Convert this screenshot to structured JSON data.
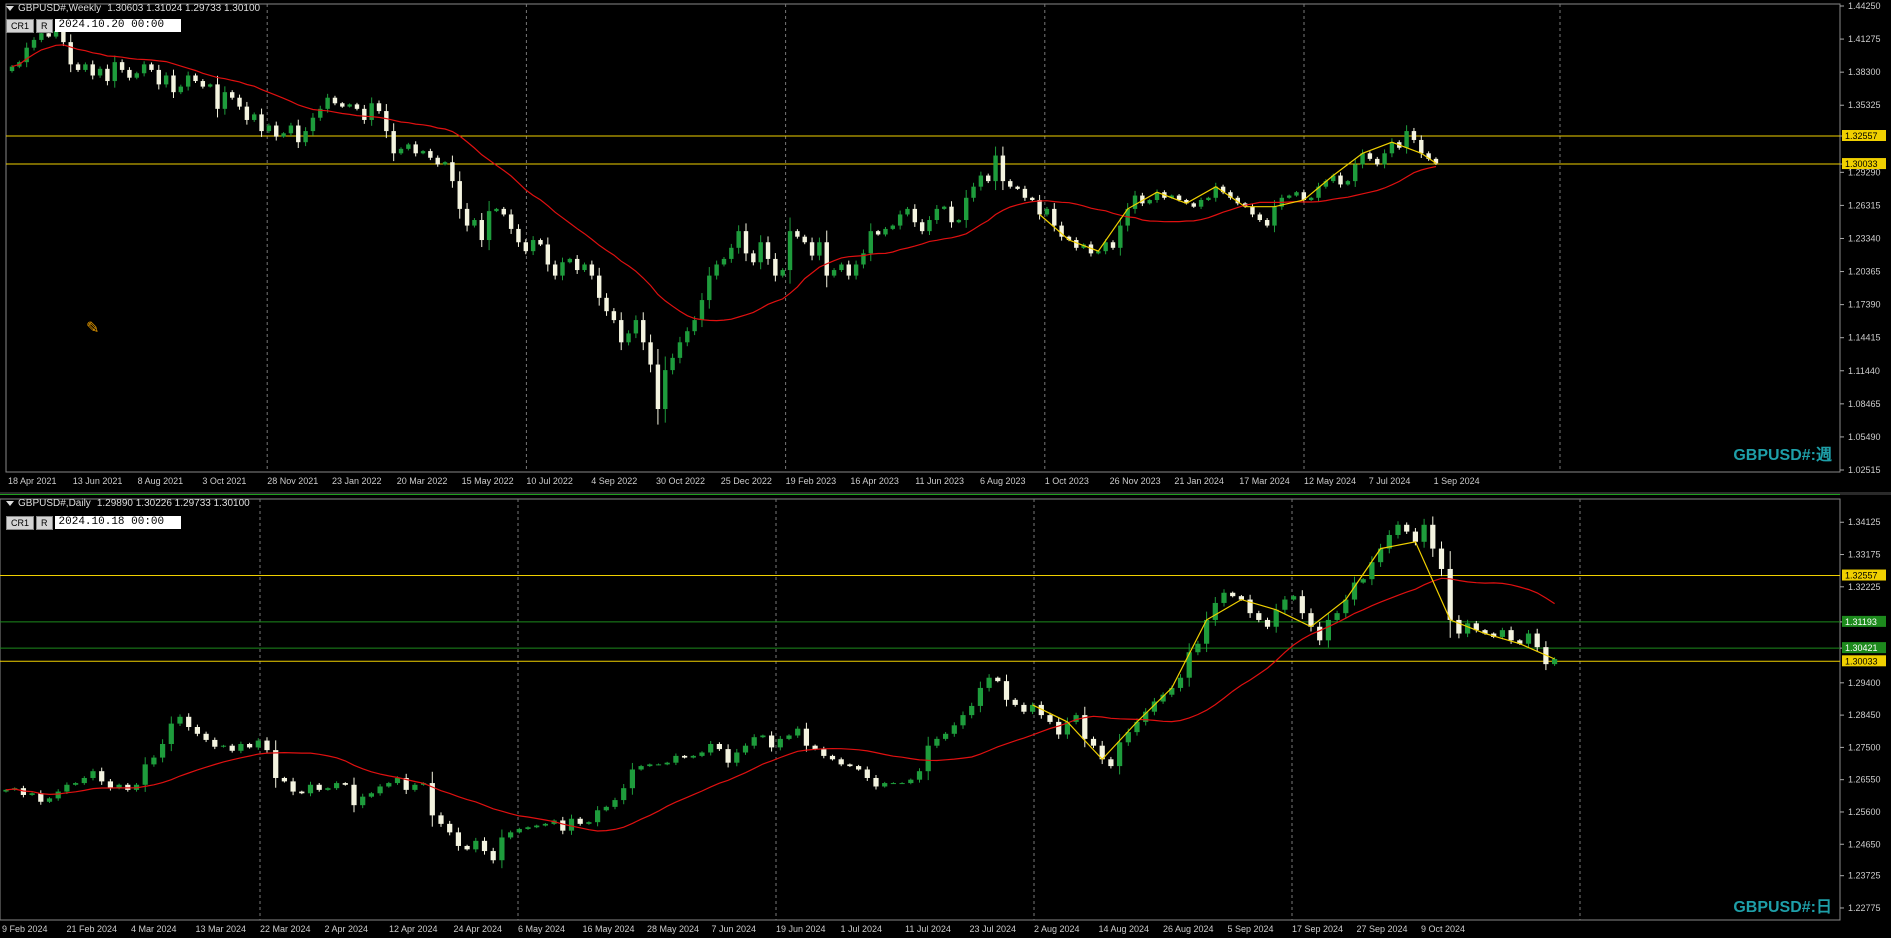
{
  "weekly": {
    "symbol_tf": "GBPUSD#,Weekly",
    "ohlc": "1.30603 1.31024 1.29733 1.30100",
    "btn_cr1": "CR1",
    "btn_r": "R",
    "date_input": "2024.10.20 00:00",
    "watermark": "GBPUSD#:週",
    "price_labels": [
      "1.44250",
      "1.41275",
      "1.38300",
      "1.35325",
      "1.32557",
      "1.30033",
      "1.29290",
      "1.26315",
      "1.23340",
      "1.20365",
      "1.17390",
      "1.14415",
      "1.11440",
      "1.08465",
      "1.05490",
      "1.02515"
    ],
    "time_labels": [
      "18 Apr 2021",
      "13 Jun 2021",
      "8 Aug 2021",
      "3 Oct 2021",
      "28 Nov 2021",
      "23 Jan 2022",
      "20 Mar 2022",
      "15 May 2022",
      "10 Jul 2022",
      "4 Sep 2022",
      "30 Oct 2022",
      "25 Dec 2022",
      "19 Feb 2023",
      "16 Apr 2023",
      "11 Jun 2023",
      "6 Aug 2023",
      "1 Oct 2023",
      "26 Nov 2023",
      "21 Jan 2024",
      "17 Mar 2024",
      "12 May 2024",
      "7 Jul 2024",
      "1 Sep 2024"
    ],
    "hlines": [
      {
        "price": 1.32557,
        "label": "1.32557",
        "color": "#f0d000"
      },
      {
        "price": 1.30033,
        "label": "1.30033",
        "color": "#f0d000"
      }
    ]
  },
  "daily": {
    "symbol_tf": "GBPUSD#,Daily",
    "ohlc": "1.29890 1.30226 1.29733 1.30100",
    "btn_cr1": "CR1",
    "btn_r": "R",
    "date_input": "2024.10.18 00:00",
    "watermark": "GBPUSD#:日",
    "price_labels": [
      "1.34125",
      "1.33175",
      "1.32225",
      "1.31193",
      "1.30421",
      "1.29400",
      "1.28450",
      "1.27500",
      "1.26550",
      "1.25600",
      "1.24650",
      "1.23725",
      "1.22775"
    ],
    "time_labels": [
      "9 Feb 2024",
      "21 Feb 2024",
      "4 Mar 2024",
      "13 Mar 2024",
      "22 Mar 2024",
      "2 Apr 2024",
      "12 Apr 2024",
      "24 Apr 2024",
      "6 May 2024",
      "16 May 2024",
      "28 May 2024",
      "7 Jun 2024",
      "19 Jun 2024",
      "1 Jul 2024",
      "11 Jul 2024",
      "23 Jul 2024",
      "2 Aug 2024",
      "14 Aug 2024",
      "26 Aug 2024",
      "5 Sep 2024",
      "17 Sep 2024",
      "27 Sep 2024",
      "9 Oct 2024"
    ],
    "hlines": [
      {
        "price": 1.32557,
        "label": "1.32557",
        "color": "#f0d000"
      },
      {
        "price": 1.31193,
        "label": "1.31193",
        "color": "#1d8a1d"
      },
      {
        "price": 1.30421,
        "label": "1.30421",
        "color": "#1d8a1d"
      },
      {
        "price": 1.30033,
        "label": "1.30033",
        "color": "#f0d000"
      }
    ]
  },
  "chart_data": [
    {
      "type": "candlestick",
      "title": "GBPUSD#,Weekly",
      "ylim": [
        1.02515,
        1.4425
      ],
      "ma_color": "#e01010",
      "zigzag_color": "#f0d000",
      "closes": [
        1.388,
        1.392,
        1.405,
        1.412,
        1.418,
        1.415,
        1.42,
        1.41,
        1.39,
        1.385,
        1.39,
        1.38,
        1.386,
        1.375,
        1.392,
        1.385,
        1.378,
        1.382,
        1.39,
        1.385,
        1.372,
        1.38,
        1.365,
        1.37,
        1.38,
        1.375,
        1.37,
        1.372,
        1.35,
        1.365,
        1.36,
        1.352,
        1.34,
        1.345,
        1.33,
        1.335,
        1.325,
        1.328,
        1.335,
        1.32,
        1.33,
        1.342,
        1.35,
        1.36,
        1.355,
        1.352,
        1.354,
        1.35,
        1.34,
        1.355,
        1.348,
        1.33,
        1.31,
        1.314,
        1.318,
        1.31,
        1.312,
        1.306,
        1.3,
        1.302,
        1.285,
        1.26,
        1.245,
        1.25,
        1.232,
        1.258,
        1.26,
        1.255,
        1.242,
        1.23,
        1.222,
        1.232,
        1.228,
        1.21,
        1.2,
        1.212,
        1.215,
        1.205,
        1.21,
        1.2,
        1.18,
        1.168,
        1.16,
        1.14,
        1.148,
        1.16,
        1.14,
        1.12,
        1.08,
        1.115,
        1.126,
        1.14,
        1.15,
        1.16,
        1.178,
        1.2,
        1.21,
        1.215,
        1.225,
        1.24,
        1.22,
        1.212,
        1.23,
        1.215,
        1.2,
        1.205,
        1.24,
        1.235,
        1.23,
        1.218,
        1.23,
        1.2,
        1.205,
        1.21,
        1.2,
        1.21,
        1.22,
        1.24,
        1.237,
        1.242,
        1.245,
        1.255,
        1.26,
        1.248,
        1.24,
        1.25,
        1.26,
        1.262,
        1.248,
        1.25,
        1.27,
        1.28,
        1.29,
        1.285,
        1.308,
        1.285,
        1.28,
        1.278,
        1.27,
        1.268,
        1.255,
        1.26,
        1.245,
        1.235,
        1.232,
        1.225,
        1.228,
        1.22,
        1.222,
        1.23,
        1.225,
        1.245,
        1.26,
        1.272,
        1.265,
        1.268,
        1.275,
        1.27,
        1.272,
        1.268,
        1.265,
        1.262,
        1.268,
        1.27,
        1.28,
        1.275,
        1.27,
        1.265,
        1.262,
        1.255,
        1.25,
        1.245,
        1.262,
        1.27,
        1.272,
        1.275,
        1.268,
        1.27,
        1.28,
        1.285,
        1.29,
        1.282,
        1.285,
        1.3,
        1.31,
        1.305,
        1.3,
        1.31,
        1.32,
        1.315,
        1.33,
        1.322,
        1.31,
        1.305,
        1.301
      ]
    },
    {
      "type": "candlestick",
      "title": "GBPUSD#,Daily",
      "ylim": [
        1.2248,
        1.3475
      ],
      "ma_color": "#e01010",
      "zigzag_color": "#f0d000",
      "closes": [
        1.2625,
        1.263,
        1.261,
        1.2615,
        1.259,
        1.26,
        1.262,
        1.264,
        1.2645,
        1.266,
        1.268,
        1.265,
        1.263,
        1.264,
        1.2625,
        1.264,
        1.27,
        1.272,
        1.276,
        1.282,
        1.284,
        1.281,
        1.279,
        1.2772,
        1.2752,
        1.2755,
        1.274,
        1.276,
        1.275,
        1.277,
        1.2742,
        1.266,
        1.265,
        1.262,
        1.2615,
        1.264,
        1.2625,
        1.263,
        1.2645,
        1.264,
        1.258,
        1.2605,
        1.2615,
        1.2635,
        1.2645,
        1.266,
        1.2625,
        1.264,
        1.2645,
        1.255,
        1.2525,
        1.25,
        1.246,
        1.245,
        1.2475,
        1.2445,
        1.2418,
        1.2485,
        1.25,
        1.251,
        1.2515,
        1.252,
        1.2525,
        1.2535,
        1.2505,
        1.254,
        1.2525,
        1.253,
        1.2565,
        1.2575,
        1.2595,
        1.263,
        1.2685,
        1.2695,
        1.27,
        1.27,
        1.2705,
        1.2725,
        1.272,
        1.2725,
        1.2735,
        1.276,
        1.2745,
        1.2705,
        1.2735,
        1.2755,
        1.278,
        1.2785,
        1.275,
        1.2775,
        1.2785,
        1.2805,
        1.2755,
        1.2745,
        1.2725,
        1.2715,
        1.27,
        1.2695,
        1.2685,
        1.266,
        1.2635,
        1.2645,
        1.2645,
        1.2645,
        1.2655,
        1.268,
        1.2755,
        1.2775,
        1.279,
        1.2815,
        1.2845,
        1.2872,
        1.2925,
        1.2955,
        1.2945,
        1.289,
        1.2875,
        1.2855,
        1.2875,
        1.2845,
        1.2825,
        1.2788,
        1.2825,
        1.2845,
        1.2775,
        1.2755,
        1.2715,
        1.2695,
        1.2765,
        1.2795,
        1.2825,
        1.2855,
        1.2885,
        1.2905,
        1.2925,
        1.2955,
        1.303,
        1.3055,
        1.3125,
        1.3175,
        1.3205,
        1.3195,
        1.3185,
        1.3145,
        1.3125,
        1.3105,
        1.3155,
        1.3185,
        1.3195,
        1.3145,
        1.3105,
        1.3065,
        1.3125,
        1.3145,
        1.3185,
        1.3235,
        1.3245,
        1.3295,
        1.3335,
        1.3375,
        1.3405,
        1.3385,
        1.3355,
        1.3405,
        1.3335,
        1.3275,
        1.3125,
        1.3085,
        1.3115,
        1.3095,
        1.3085,
        1.3075,
        1.3095,
        1.3065,
        1.3055,
        1.3085,
        1.3045,
        1.2995,
        1.301
      ]
    }
  ]
}
